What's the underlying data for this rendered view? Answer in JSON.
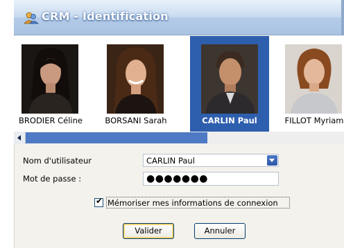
{
  "window": {
    "title": "CRM - Identification"
  },
  "users": [
    {
      "name": "BRODIER Céline",
      "selected": false
    },
    {
      "name": "BORSANI Sarah",
      "selected": false
    },
    {
      "name": "CARLIN Paul",
      "selected": true
    },
    {
      "name": "FILLOT Myriam",
      "selected": false
    }
  ],
  "form": {
    "username_label": "Nom d'utilisateur",
    "username_value": "CARLIN Paul",
    "password_label": "Mot de passe :",
    "password_mask": "●●●●●●●",
    "remember_label": "Mémoriser mes informations de connexion",
    "remember_checked": true,
    "check_glyph": "✔"
  },
  "buttons": {
    "validate": "Valider",
    "cancel": "Annuler"
  },
  "colors": {
    "selection": "#2e5fae",
    "scroll_thumb": "#4e79c4"
  }
}
